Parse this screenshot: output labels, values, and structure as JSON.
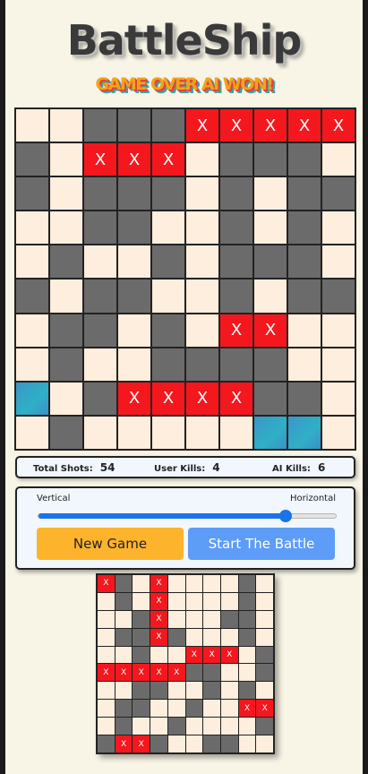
{
  "title": "BattleShip",
  "status": "GAME OVER AI WON!",
  "stats": {
    "total_shots_label": "Total Shots:",
    "total_shots": "54",
    "user_kills_label": "User Kills:",
    "user_kills": "4",
    "ai_kills_label": "AI Kills:",
    "ai_kills": "6"
  },
  "controls": {
    "vertical_label": "Vertical",
    "horizontal_label": "Horizontal",
    "orientation_slider_value": 0.83,
    "new_game_label": "New Game",
    "start_label": "Start The Battle"
  },
  "colors": {
    "empty": "#fdeedd",
    "ship": "#6b6b6b",
    "hit": "#f5171e",
    "water_marker": "#3b96c8",
    "new_game_button": "#fdb32c",
    "start_button": "#5d9cf7"
  },
  "cell_legend": {
    "E": "empty",
    "S": "ship",
    "H": "hit",
    "W": "water"
  },
  "hit_mark": "X",
  "main_board": [
    "EESSSHHHHH",
    "SEHHHESSSE",
    "SESSSESESS",
    "EESSEESESE",
    "ESEESESSSE",
    "SESSEESESS",
    "ESSESEHHEE",
    "ESEESSSSEE",
    "WESHHHHSSE",
    "ESEEEEEWWE"
  ],
  "mini_board": [
    "HSEHEEEESE",
    "ESEHEEEESE",
    "EESHEEESSE",
    "ESSHSEEESE",
    "EESEEHHHES",
    "HHHHHSSEES",
    "EESSEESESE",
    "ESSEESEEHH",
    "ESEESEEEES",
    "SHHSEESSEE"
  ]
}
